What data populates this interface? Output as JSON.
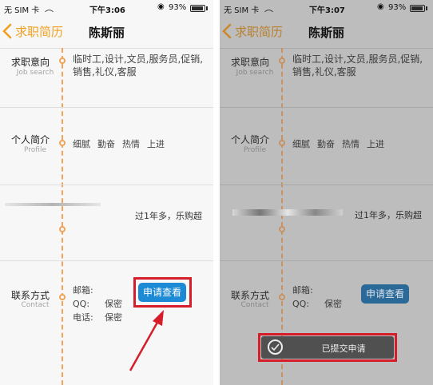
{
  "status_left": {
    "carrier": "无 SIM 卡",
    "time": "下午3:06",
    "battery": "93%"
  },
  "status_right": {
    "carrier": "无 SIM 卡",
    "time": "下午3:07",
    "battery": "93%"
  },
  "nav": {
    "back_label": "求职简历",
    "title": "陈斯丽"
  },
  "sections": {
    "job": {
      "title": "求职意向",
      "subtitle": "Job search",
      "line1": "临时工,设计,文员,服务员,促销,",
      "line2": "销售,礼仪,客服"
    },
    "profile": {
      "title": "个人简介",
      "subtitle": "Profile",
      "tags": [
        "细腻",
        "勤奋",
        "热情",
        "上进"
      ]
    },
    "experience": {
      "text": "过1年多，乐购超"
    },
    "contact": {
      "title": "联系方式",
      "subtitle": "Contact",
      "mailbox_label": "邮箱:",
      "qq_label": "QQ:",
      "qq_value": "保密",
      "phone_label": "电话:",
      "phone_value": "保密",
      "apply_button": "申请查看"
    }
  },
  "toast": {
    "message": "已提交申请"
  },
  "colors": {
    "accent": "#f0a020",
    "button": "#1d8ad6",
    "highlight": "#d61d2a"
  }
}
